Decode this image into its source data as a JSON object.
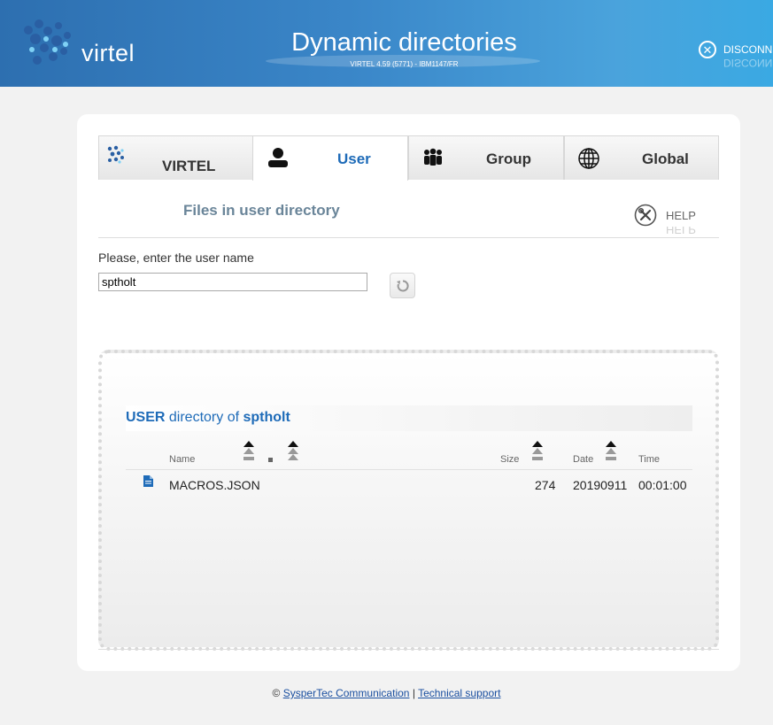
{
  "header": {
    "logo_text": "virtel",
    "title": "Dynamic directories",
    "subtitle": "VIRTEL 4.59 (5771) - IBM1147/FR",
    "disconnect_label": "DISCONN"
  },
  "tabs": [
    {
      "label": "VIRTEL",
      "icon": "virtel-grid-icon",
      "active": false
    },
    {
      "label": "User",
      "icon": "user-icon",
      "active": true
    },
    {
      "label": "Group",
      "icon": "group-icon",
      "active": false
    },
    {
      "label": "Global",
      "icon": "globe-icon",
      "active": false
    }
  ],
  "section": {
    "title": "Files in user directory",
    "help_label": "HELP"
  },
  "form": {
    "prompt": "Please, enter the user name",
    "username_value": "sptholt"
  },
  "directory": {
    "title_kind": "USER",
    "title_mid": " directory of ",
    "title_owner": "sptholt",
    "columns": {
      "name": "Name",
      "size": "Size",
      "date": "Date",
      "time": "Time"
    },
    "rows": [
      {
        "icon": "file-icon",
        "name": "MACROS.JSON",
        "size": "274",
        "date": "20190911",
        "time": "00:01:00"
      }
    ]
  },
  "footer": {
    "copyright": "©",
    "company_link": "SysperTec Communication",
    "separator": "|",
    "support_link": "Technical support"
  },
  "colors": {
    "header_blue": "#3a86c8",
    "accent": "#1e6bb8",
    "section_title": "#6a8599"
  }
}
